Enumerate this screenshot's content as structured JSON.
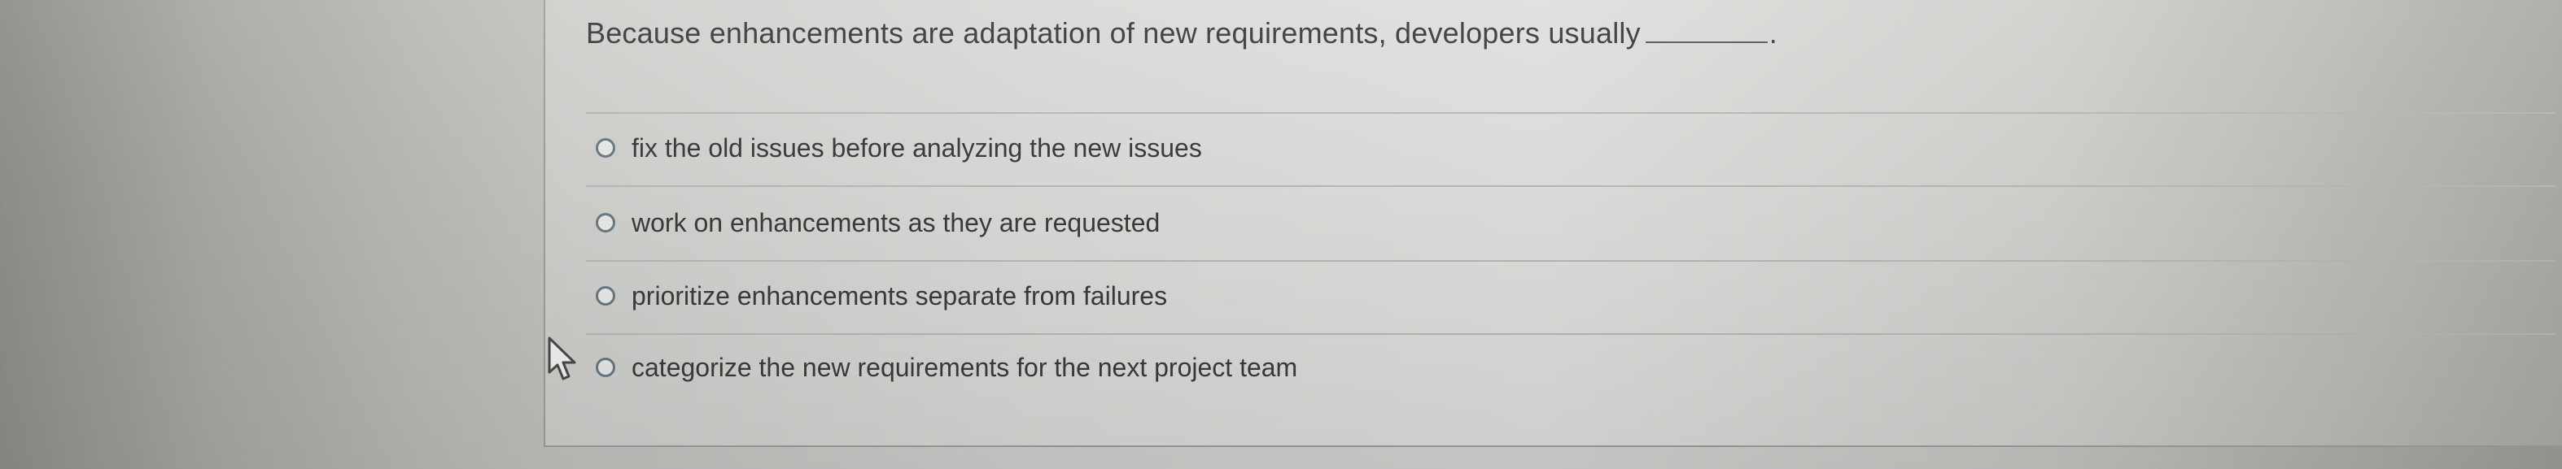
{
  "question": {
    "text": "Because enhancements are adaptation of new requirements, developers usually",
    "period": "."
  },
  "choices": [
    {
      "label": "fix the old issues before analyzing the new issues"
    },
    {
      "label": "work on enhancements as they are requested"
    },
    {
      "label": "prioritize enhancements separate from failures"
    },
    {
      "label": "categorize the new requirements for the next project team"
    }
  ],
  "icons": {
    "radio": "radio-unselected-icon",
    "cursor": "mouse-pointer-icon"
  },
  "colors": {
    "text": "#3d3d3b",
    "radio_border": "#6a7a82",
    "divider": "#b8b9b5"
  }
}
